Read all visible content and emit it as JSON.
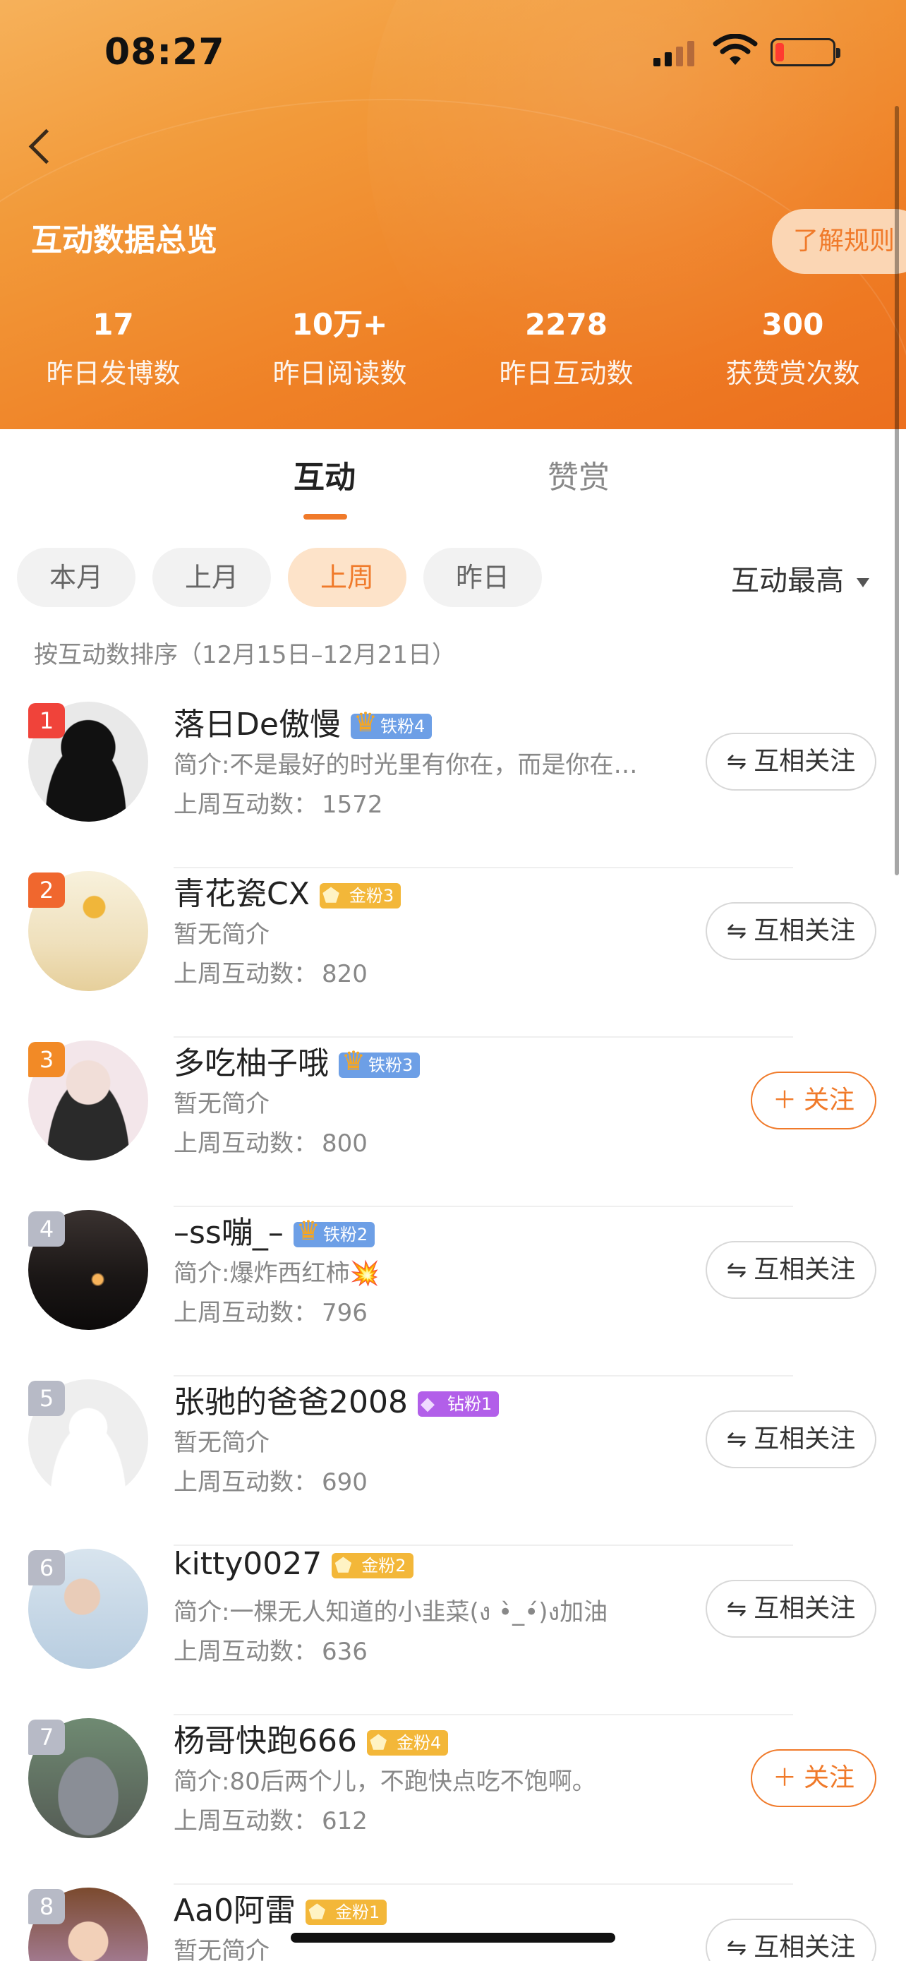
{
  "status_bar": {
    "time": "08:27"
  },
  "header": {
    "title": "互动数据总览",
    "rules_label": "了解规则",
    "stats": [
      {
        "value": "17",
        "label": "昨日发博数"
      },
      {
        "value": "10万+",
        "label": "昨日阅读数"
      },
      {
        "value": "2278",
        "label": "昨日互动数"
      },
      {
        "value": "300",
        "label": "获赞赏次数"
      }
    ]
  },
  "tabs": [
    {
      "label": "互动",
      "active": true
    },
    {
      "label": "赞赏",
      "active": false
    }
  ],
  "filters": [
    {
      "label": "本月",
      "active": false
    },
    {
      "label": "上月",
      "active": false
    },
    {
      "label": "上周",
      "active": true
    },
    {
      "label": "昨日",
      "active": false
    }
  ],
  "sort": {
    "label": "互动最高"
  },
  "sort_description": "按互动数排序（12月15日–12月21日）",
  "count_label": "上周互动数：",
  "buttons": {
    "mutual": "互相关注",
    "follow": "关注"
  },
  "colors": {
    "accent": "#f07a2a",
    "header_start": "#f6b15a",
    "header_end": "#ec6f1e"
  },
  "users": [
    {
      "rank": "1",
      "name": "落日De傲慢",
      "badge": "铁粉4",
      "badge_type": "iron",
      "bio": "简介:不是最好的时光里有你在，而是你在…",
      "count": "1572",
      "button": "mutual"
    },
    {
      "rank": "2",
      "name": "青花瓷CX",
      "badge": "金粉3",
      "badge_type": "gold",
      "bio": "暂无简介",
      "count": "820",
      "button": "mutual"
    },
    {
      "rank": "3",
      "name": "多吃柚子哦",
      "badge": "铁粉3",
      "badge_type": "iron",
      "bio": "暂无简介",
      "count": "800",
      "button": "follow"
    },
    {
      "rank": "4",
      "name": "–ss嘣_–",
      "badge": "铁粉2",
      "badge_type": "iron",
      "bio": "简介:爆炸西红柿💥",
      "count": "796",
      "button": "mutual"
    },
    {
      "rank": "5",
      "name": "张驰的爸爸2008",
      "badge": "钻粉1",
      "badge_type": "diamond",
      "bio": "暂无简介",
      "count": "690",
      "button": "mutual"
    },
    {
      "rank": "6",
      "name": "kitty0027",
      "badge": "金粉2",
      "badge_type": "gold",
      "bio": "简介:一棵无人知道的小韭菜(ง •̀_•́)ง加油",
      "count": "636",
      "button": "mutual"
    },
    {
      "rank": "7",
      "name": "杨哥快跑666",
      "badge": "金粉4",
      "badge_type": "gold",
      "bio": "简介:80后两个儿，不跑快点吃不饱啊。",
      "count": "612",
      "button": "follow"
    },
    {
      "rank": "8",
      "name": "Aa0阿雷",
      "badge": "金粉1",
      "badge_type": "gold",
      "bio": "暂无简介",
      "count": "",
      "button": "mutual"
    }
  ]
}
